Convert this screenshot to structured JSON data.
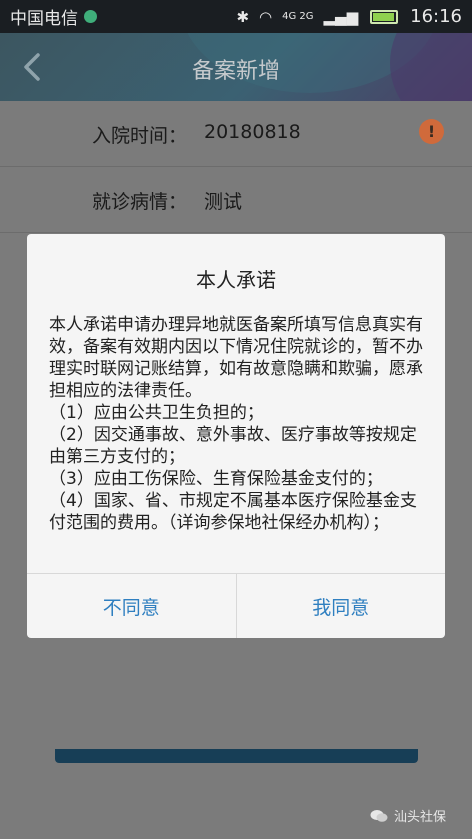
{
  "status_bar": {
    "carrier": "中国电信",
    "network": "4G 2G",
    "time": "16:16",
    "battery_level": 0.88
  },
  "header": {
    "title": "备案新增"
  },
  "form": {
    "fields": [
      {
        "label": "入院时间：",
        "value": "20180818"
      },
      {
        "label": "就诊病情：",
        "value": "测试"
      }
    ]
  },
  "dialog": {
    "title": "本人承诺",
    "paragraphs": [
      "本人承诺申请办理异地就医备案所填写信息真实有效，备案有效期内因以下情况住院就诊的，暂不办理实时联网记账结算，如有故意隐瞒和欺骗，愿承担相应的法律责任。",
      "（1）应由公共卫生负担的；",
      "（2）因交通事故、意外事故、医疗事故等按规定由第三方支付的；",
      "（3）应由工伤保险、生育保险基金支付的；",
      "（4）国家、省、市规定不属基本医疗保险基金支付范围的费用。（详询参保地社保经办机构）；"
    ],
    "buttons": {
      "disagree": "不同意",
      "agree": "我同意"
    }
  },
  "watermark": "汕头社保",
  "colors": {
    "accent": "#2f7fc0",
    "warning": "#d06a3b"
  }
}
